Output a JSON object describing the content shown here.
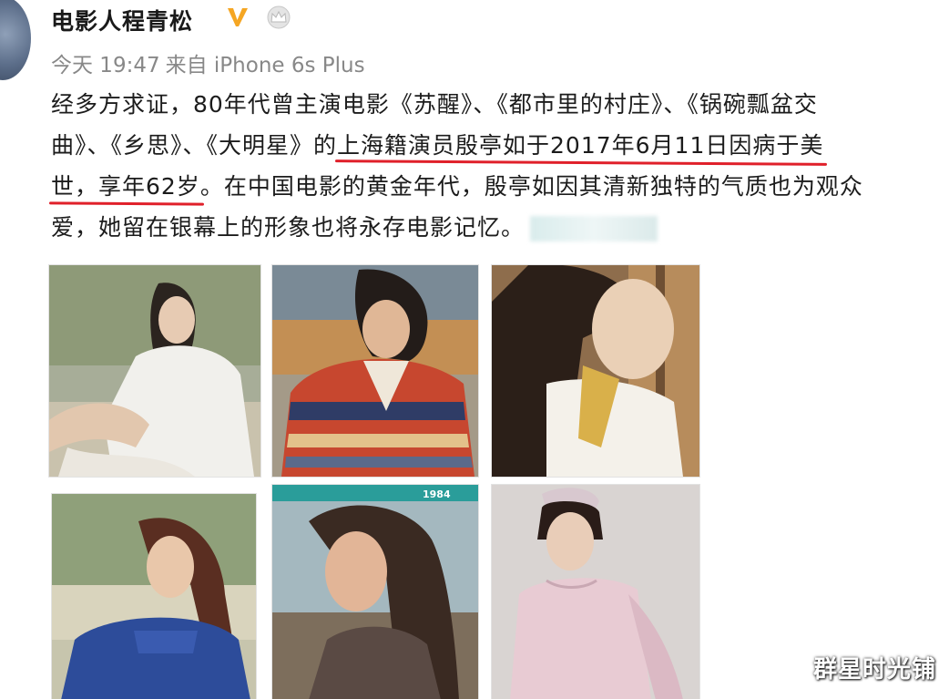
{
  "post": {
    "username": "电影人程青松",
    "timestamp": "今天 19:47",
    "source": "来自 iPhone 6s Plus",
    "lines": [
      [
        "经多方求证，80年代曾主演电影《苏醒》、《都市里的村庄》、《锅碗瓢盆交"
      ],
      [
        "曲》、《乡思》、《大明星》的",
        "上海籍演员殷亭如于2017年6月11日因病于美"
      ],
      [
        "世，享年62岁",
        "。在中国电影的黄金年代，殷亭如因其清新独特的气质也为观众"
      ],
      [
        "爱，她留在银幕上的形象也将永存电影记忆。"
      ]
    ],
    "photos": [
      "photo-1",
      "photo-2",
      "photo-3",
      "photo-4",
      "photo-5-magazine",
      "photo-6"
    ],
    "magazine_cover_text": "1984"
  },
  "icons": {
    "verified": "verified-v-icon",
    "member": "crown-icon"
  },
  "watermark": "群星时光铺",
  "colors": {
    "underline": "#e0202a",
    "verified": "#f5a623",
    "meta": "#888888"
  }
}
